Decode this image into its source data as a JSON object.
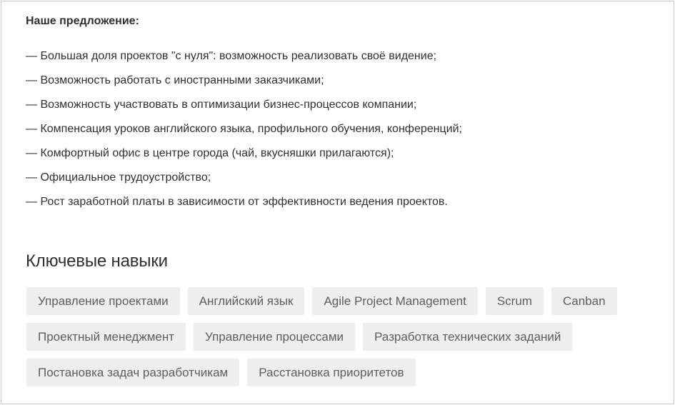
{
  "offer": {
    "title": "Наше предложение:",
    "items": [
      "— Большая доля проектов \"с нуля\": возможность реализовать своё видение;",
      "— Возможность работать с иностранными заказчиками;",
      "— Возможность участвовать в оптимизации бизнес-процессов компании;",
      "— Компенсация уроков английского языка, профильного обучения, конференций;",
      "— Комфортный офис в центре города (чай, вкусняшки прилагаются);",
      "— Официальное трудоустройство;",
      "— Рост заработной платы в зависимости от эффективности ведения проектов."
    ]
  },
  "skills": {
    "heading": "Ключевые навыки",
    "rows": [
      [
        "Управление проектами",
        "Английский язык",
        "Agile Project Management",
        "Scrum",
        "Canban"
      ],
      [
        "Проектный менеджмент",
        "Управление процессами",
        "Разработка технических заданий"
      ],
      [
        "Постановка задач разработчикам",
        "Расстановка приоритетов"
      ]
    ]
  }
}
